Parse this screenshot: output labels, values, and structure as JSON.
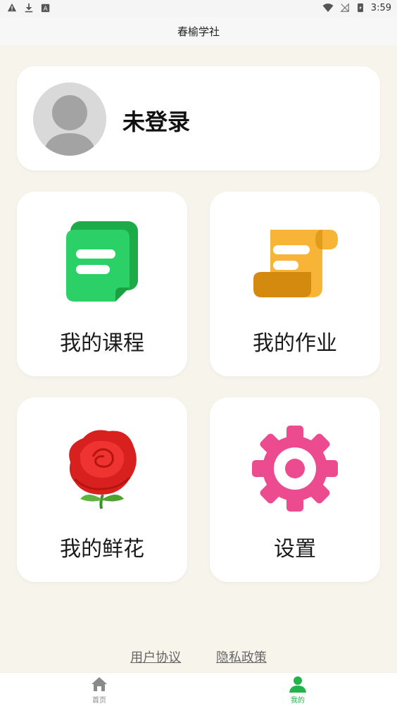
{
  "status_bar": {
    "time": "3:59",
    "left_icons": [
      "warning-icon",
      "download-icon",
      "app-a-icon"
    ],
    "right_icons": [
      "wifi-icon",
      "no-signal-icon",
      "battery-icon"
    ]
  },
  "header": {
    "title": "春榆学社"
  },
  "profile": {
    "login_label": "未登录",
    "avatar": "default-avatar"
  },
  "tiles": [
    {
      "label": "我的课程",
      "icon": "chat-document-icon",
      "color": "#27c25c"
    },
    {
      "label": "我的作业",
      "icon": "scroll-icon",
      "color": "#f5a623"
    },
    {
      "label": "我的鲜花",
      "icon": "rose-icon",
      "color": "#d8201e"
    },
    {
      "label": "设置",
      "icon": "gear-icon",
      "color": "#ec4b8f"
    }
  ],
  "footer_links": {
    "user_agreement": "用户协议",
    "privacy_policy": "隐私政策"
  },
  "bottom_nav": [
    {
      "label": "首页",
      "icon": "home-icon",
      "active": false
    },
    {
      "label": "我的",
      "icon": "user-icon",
      "active": true
    }
  ],
  "colors": {
    "accent": "#22b34a",
    "background": "#f7f4ec"
  }
}
